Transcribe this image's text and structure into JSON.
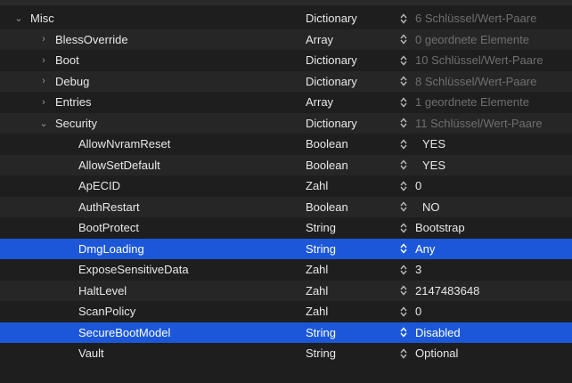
{
  "rows": [
    {
      "key": "Misc",
      "type": "Dictionary",
      "value": "6 Schlüssel/Wert-Paare",
      "disclosure": "expanded",
      "muted": true
    },
    {
      "key": "BlessOverride",
      "type": "Array",
      "value": "0 geordnete Elemente",
      "disclosure": "collapsed",
      "muted": true
    },
    {
      "key": "Boot",
      "type": "Dictionary",
      "value": "10 Schlüssel/Wert-Paare",
      "disclosure": "collapsed",
      "muted": true
    },
    {
      "key": "Debug",
      "type": "Dictionary",
      "value": "8 Schlüssel/Wert-Paare",
      "disclosure": "collapsed",
      "muted": true
    },
    {
      "key": "Entries",
      "type": "Array",
      "value": "1 geordnete Elemente",
      "disclosure": "collapsed",
      "muted": true
    },
    {
      "key": "Security",
      "type": "Dictionary",
      "value": "11 Schlüssel/Wert-Paare",
      "disclosure": "expanded",
      "muted": true
    },
    {
      "key": "AllowNvramReset",
      "type": "Boolean",
      "value": "YES"
    },
    {
      "key": "AllowSetDefault",
      "type": "Boolean",
      "value": "YES"
    },
    {
      "key": "ApECID",
      "type": "Zahl",
      "value": "0"
    },
    {
      "key": "AuthRestart",
      "type": "Boolean",
      "value": "NO"
    },
    {
      "key": "BootProtect",
      "type": "String",
      "value": "Bootstrap"
    },
    {
      "key": "DmgLoading",
      "type": "String",
      "value": "Any",
      "selected": true
    },
    {
      "key": "ExposeSensitiveData",
      "type": "Zahl",
      "value": "3"
    },
    {
      "key": "HaltLevel",
      "type": "Zahl",
      "value": "2147483648"
    },
    {
      "key": "ScanPolicy",
      "type": "Zahl",
      "value": "0"
    },
    {
      "key": "SecureBootModel",
      "type": "String",
      "value": "Disabled",
      "selected": true
    },
    {
      "key": "Vault",
      "type": "String",
      "value": "Optional"
    }
  ],
  "icons": {
    "expanded": "chevron-down-icon",
    "collapsed": "chevron-right-icon",
    "stepper": "stepper-updown-icon"
  },
  "colors": {
    "background": "#1e1e1e",
    "alt_row": "#262626",
    "selection": "#1b57d8",
    "muted_text": "#6f6f6f"
  }
}
